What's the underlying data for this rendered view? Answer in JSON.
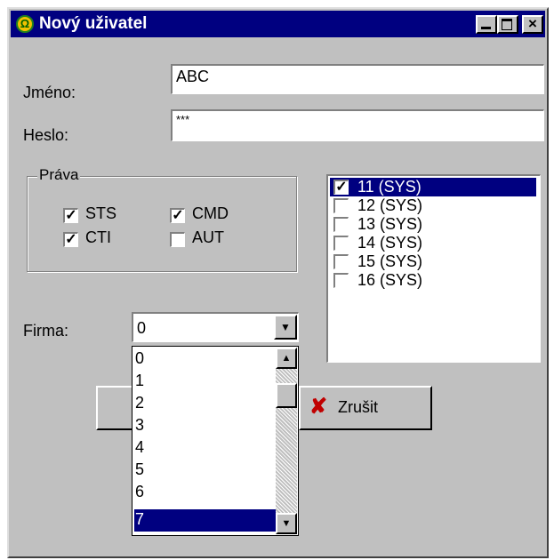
{
  "window": {
    "title": "Nový uživatel",
    "icon": "omega-logo-icon",
    "controls": {
      "minimize": "minimize-icon",
      "maximize": "maximize-icon",
      "close": "×"
    }
  },
  "form": {
    "name_label": "Jméno:",
    "name_value": "ABC",
    "password_label": "Heslo:",
    "password_value": "***",
    "rights_title": "Práva",
    "rights": [
      {
        "label": "STS",
        "checked": true
      },
      {
        "label": "CMD",
        "checked": true
      },
      {
        "label": "CTI",
        "checked": true
      },
      {
        "label": "AUT",
        "checked": false
      }
    ],
    "company_label": "Firma:",
    "company_value": "0"
  },
  "user_list": [
    {
      "label": "11 (SYS)",
      "checked": true,
      "selected": true
    },
    {
      "label": "12 (SYS)",
      "checked": false,
      "selected": false
    },
    {
      "label": "13 (SYS)",
      "checked": false,
      "selected": false
    },
    {
      "label": "14 (SYS)",
      "checked": false,
      "selected": false
    },
    {
      "label": "15 (SYS)",
      "checked": false,
      "selected": false
    },
    {
      "label": "16 (SYS)",
      "checked": false,
      "selected": false
    }
  ],
  "dropdown": {
    "options": [
      "0",
      "1",
      "2",
      "3",
      "4",
      "5",
      "6",
      "7"
    ],
    "highlighted": "7"
  },
  "buttons": {
    "cancel_label": "Zrušit",
    "cancel_icon": "red-x-icon"
  },
  "colors": {
    "titlebar": "#000080",
    "window_face": "#c0c0c0",
    "selection": "#000080",
    "cancel_icon": "#c00000"
  }
}
